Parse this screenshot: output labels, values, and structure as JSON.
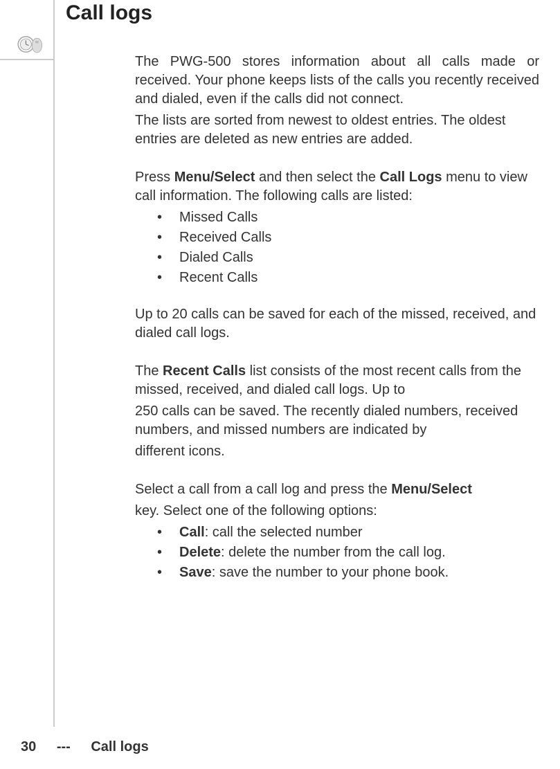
{
  "title": "Call logs",
  "intro1": "The PWG-500 stores information about all calls made or received. Your phone keeps lists of the calls you recently received and dialed, even if the calls did not connect.",
  "intro2": "The lists are sorted from newest to oldest entries. The oldest entries are deleted as new entries are added.",
  "press_pre": "Press ",
  "press_b1": "Menu/Select",
  "press_mid": " and then select the ",
  "press_b2": "Call Logs",
  "press_post": " menu to view call information. The following calls are listed:",
  "list1": {
    "i0": "Missed Calls",
    "i1": "Received Calls",
    "i2": "Dialed Calls",
    "i3": "Recent Calls"
  },
  "upto": "Up to 20 calls can be saved for each of the missed, received, and dialed call logs.",
  "recent_pre": "The ",
  "recent_b": "Recent Calls",
  "recent_post1": " list consists of the most recent calls from the missed, received, and dialed call logs. Up to",
  "recent_post2": "250 calls can be saved. The recently dialed numbers, received numbers, and missed numbers are indicated by",
  "recent_post3": "different icons.",
  "select_pre": "Select a call from a call log and press the ",
  "select_b": "Menu/Select",
  "select_post": "key. Select one of the following options:",
  "list2": {
    "i0_b": "Call",
    "i0_t": ": call the selected number",
    "i1_b": "Delete",
    "i1_t": ": delete the number from the call log.",
    "i2_b": "Save",
    "i2_t": ": save the number to your phone book."
  },
  "footer": {
    "page": "30",
    "dash": "---",
    "label": "Call logs"
  }
}
